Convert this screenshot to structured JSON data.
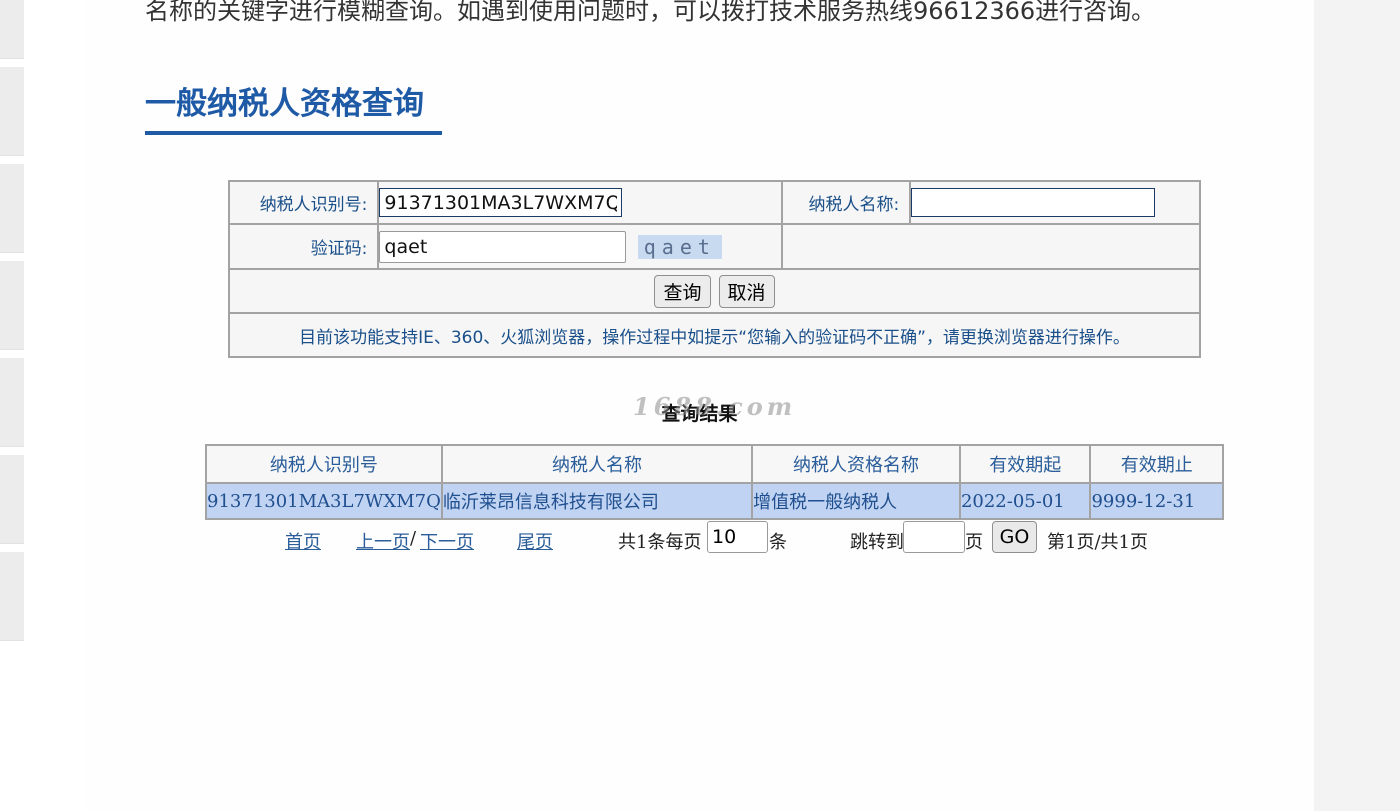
{
  "intro_text": "名称的关键字进行模糊查询。如遇到使用问题时，可以拨打技术服务热线96612366进行咨询。",
  "section_title": "一般纳税人资格查询",
  "form": {
    "taxpayer_id_label": "纳税人识别号:",
    "taxpayer_id_value": "91371301MA3L7WXM7Q",
    "taxpayer_name_label": "纳税人名称:",
    "taxpayer_name_value": "",
    "captcha_label": "验证码:",
    "captcha_value": "qaet",
    "captcha_image_text": "qaet",
    "query_button": "查询",
    "cancel_button": "取消",
    "notice": "目前该功能支持IE、360、火狐浏览器，操作过程中如提示“您输入的验证码不正确”，请更换浏览器进行操作。"
  },
  "result": {
    "title": "查询结果",
    "watermark": "1688.com",
    "headers": [
      "纳税人识别号",
      "纳税人名称",
      "纳税人资格名称",
      "有效期起",
      "有效期止"
    ],
    "rows": [
      [
        "91371301MA3L7WXM7Q",
        "临沂莱昂信息科技有限公司",
        "增值税一般纳税人",
        "2022-05-01",
        "9999-12-31"
      ]
    ]
  },
  "pager": {
    "first": "首页",
    "prev": "上一页",
    "separator": "/",
    "next": "下一页",
    "last": "尾页",
    "total_prefix": "共1条每页",
    "page_size": "10",
    "unit": "条",
    "jump_label": "跳转到",
    "jump_value": "",
    "page_unit": "页",
    "go_button": "GO",
    "page_status": "第1页/共1页"
  },
  "colors": {
    "accent": "#1f5aa6",
    "result_row_bg": "#c0d3f2",
    "link": "#2a5d9a"
  }
}
